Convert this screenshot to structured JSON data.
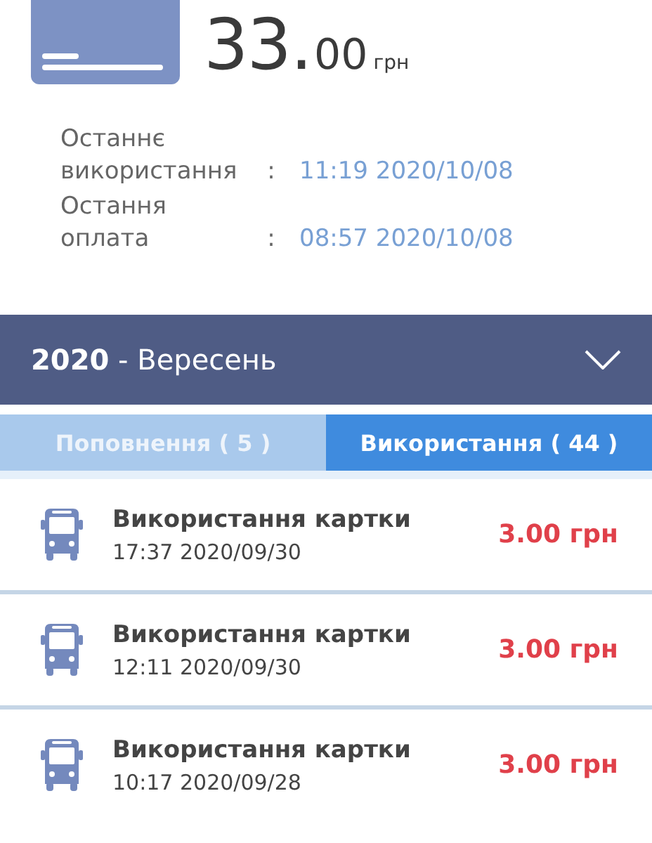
{
  "balance": {
    "whole": "33.",
    "decimals": "00",
    "currency": "грн"
  },
  "info": [
    {
      "label": "Останнє використання",
      "separator": ":",
      "value": "11:19 2020/10/08"
    },
    {
      "label": "Остання оплата",
      "separator": ":",
      "value": "08:57 2020/10/08"
    }
  ],
  "period": {
    "year": "2020",
    "month": "- Вересень",
    "expanded": false
  },
  "tabs": [
    {
      "label": "Поповнення ( 5 )",
      "selected": false
    },
    {
      "label": "Використання ( 44 )",
      "selected": true
    }
  ],
  "transactions": [
    {
      "title": "Використання картки",
      "time": "17:37 2020/09/30",
      "amount": "3.00 грн"
    },
    {
      "title": "Використання картки",
      "time": "12:11 2020/09/30",
      "amount": "3.00 грн"
    },
    {
      "title": "Використання картки",
      "time": "10:17 2020/09/28",
      "amount": "3.00 грн"
    }
  ]
}
